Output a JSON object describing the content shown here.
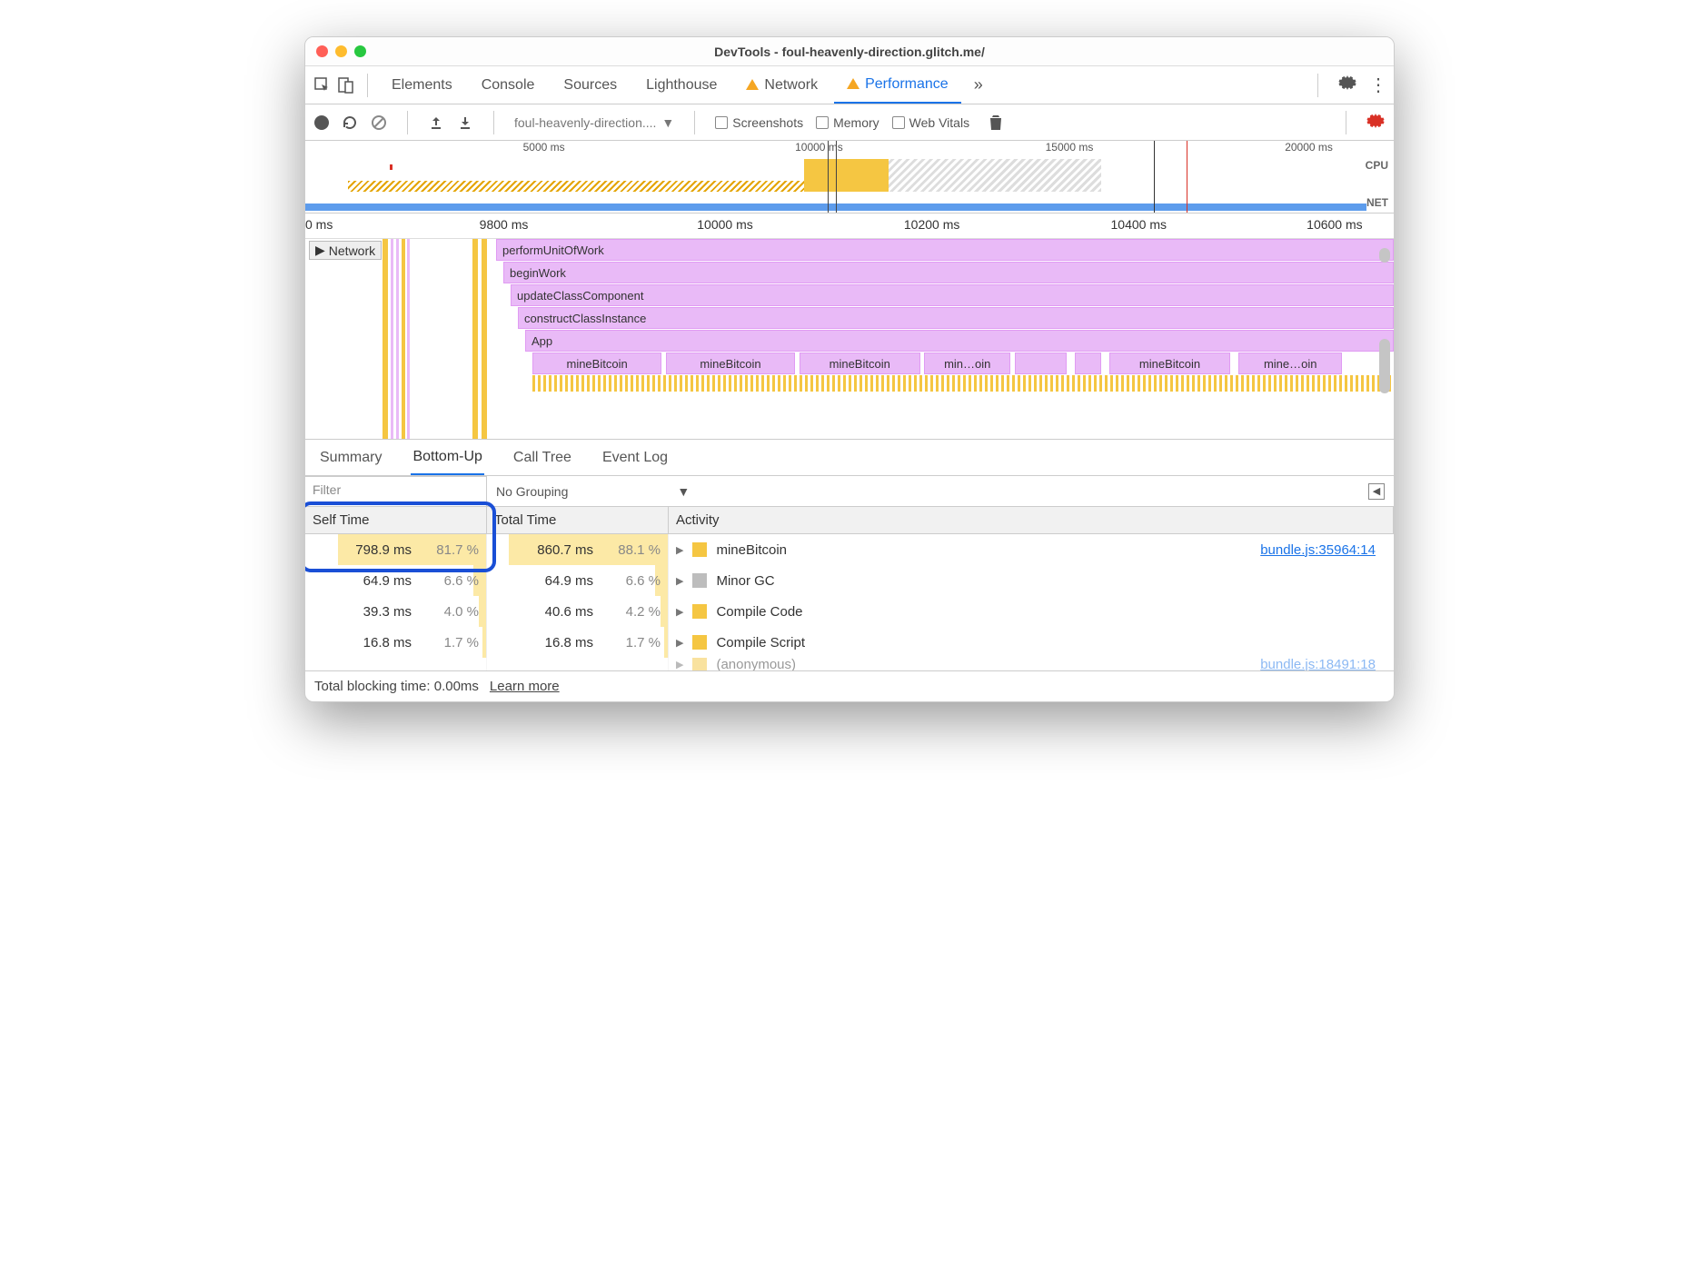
{
  "window": {
    "title": "DevTools - foul-heavenly-direction.glitch.me/"
  },
  "tabs": {
    "items": [
      "Elements",
      "Console",
      "Sources",
      "Lighthouse",
      "Network",
      "Performance"
    ],
    "active": "Performance",
    "warn": [
      "Network",
      "Performance"
    ]
  },
  "toolbar": {
    "recording_select": "foul-heavenly-direction....",
    "checks": [
      "Screenshots",
      "Memory",
      "Web Vitals"
    ]
  },
  "overview": {
    "ticks": [
      "5000 ms",
      "10000 ms",
      "15000 ms",
      "20000 ms"
    ],
    "labels": {
      "cpu": "CPU",
      "net": "NET"
    }
  },
  "timeline": {
    "ruler": [
      "0 ms",
      "9800 ms",
      "10000 ms",
      "10200 ms",
      "10400 ms",
      "10600 ms"
    ],
    "network_label": "Network",
    "stack": [
      "performUnitOfWork",
      "beginWork",
      "updateClassComponent",
      "constructClassInstance",
      "App"
    ],
    "bitcoin": [
      "mineBitcoin",
      "mineBitcoin",
      "mineBitcoin",
      "min…oin",
      "mineBitcoin",
      "mine…oin"
    ]
  },
  "sub_tabs": {
    "items": [
      "Summary",
      "Bottom-Up",
      "Call Tree",
      "Event Log"
    ],
    "active": "Bottom-Up"
  },
  "filter": {
    "placeholder": "Filter",
    "grouping": "No Grouping"
  },
  "bottom_up": {
    "headers": {
      "self": "Self Time",
      "total": "Total Time",
      "activity": "Activity"
    },
    "rows": [
      {
        "self_ms": "798.9 ms",
        "self_pct": "81.7 %",
        "self_bar": 82,
        "total_ms": "860.7 ms",
        "total_pct": "88.1 %",
        "total_bar": 88,
        "activity": "mineBitcoin",
        "color": "yellow",
        "link": "bundle.js:35964:14"
      },
      {
        "self_ms": "64.9 ms",
        "self_pct": "6.6 %",
        "self_bar": 7,
        "total_ms": "64.9 ms",
        "total_pct": "6.6 %",
        "total_bar": 7,
        "activity": "Minor GC",
        "color": "gray",
        "link": ""
      },
      {
        "self_ms": "39.3 ms",
        "self_pct": "4.0 %",
        "self_bar": 4,
        "total_ms": "40.6 ms",
        "total_pct": "4.2 %",
        "total_bar": 4,
        "activity": "Compile Code",
        "color": "yellow",
        "link": ""
      },
      {
        "self_ms": "16.8 ms",
        "self_pct": "1.7 %",
        "self_bar": 2,
        "total_ms": "16.8 ms",
        "total_pct": "1.7 %",
        "total_bar": 2,
        "activity": "Compile Script",
        "color": "yellow",
        "link": ""
      }
    ],
    "cutoff": {
      "activity": "(anonymous)",
      "link": "bundle.js:18491:18"
    }
  },
  "status": {
    "text": "Total blocking time: 0.00ms",
    "learn": "Learn more"
  }
}
